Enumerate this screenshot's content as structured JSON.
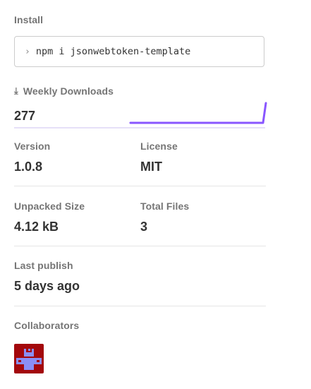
{
  "install": {
    "label": "Install",
    "command": "npm i jsonwebtoken-template",
    "prompt_icon": "chevron-right-icon"
  },
  "downloads": {
    "label": "Weekly Downloads",
    "icon": "download-icon",
    "count": "277",
    "accent_color": "#8956ff"
  },
  "stats": {
    "version": {
      "label": "Version",
      "value": "1.0.8"
    },
    "license": {
      "label": "License",
      "value": "MIT"
    },
    "unpacked_size": {
      "label": "Unpacked Size",
      "value": "4.12 kB"
    },
    "total_files": {
      "label": "Total Files",
      "value": "3"
    },
    "last_publish": {
      "label": "Last publish",
      "value": "5 days ago"
    }
  },
  "collaborators": {
    "label": "Collaborators",
    "avatar_colors": {
      "background": "#a3080c",
      "foreground": "#8b8ef5"
    }
  }
}
